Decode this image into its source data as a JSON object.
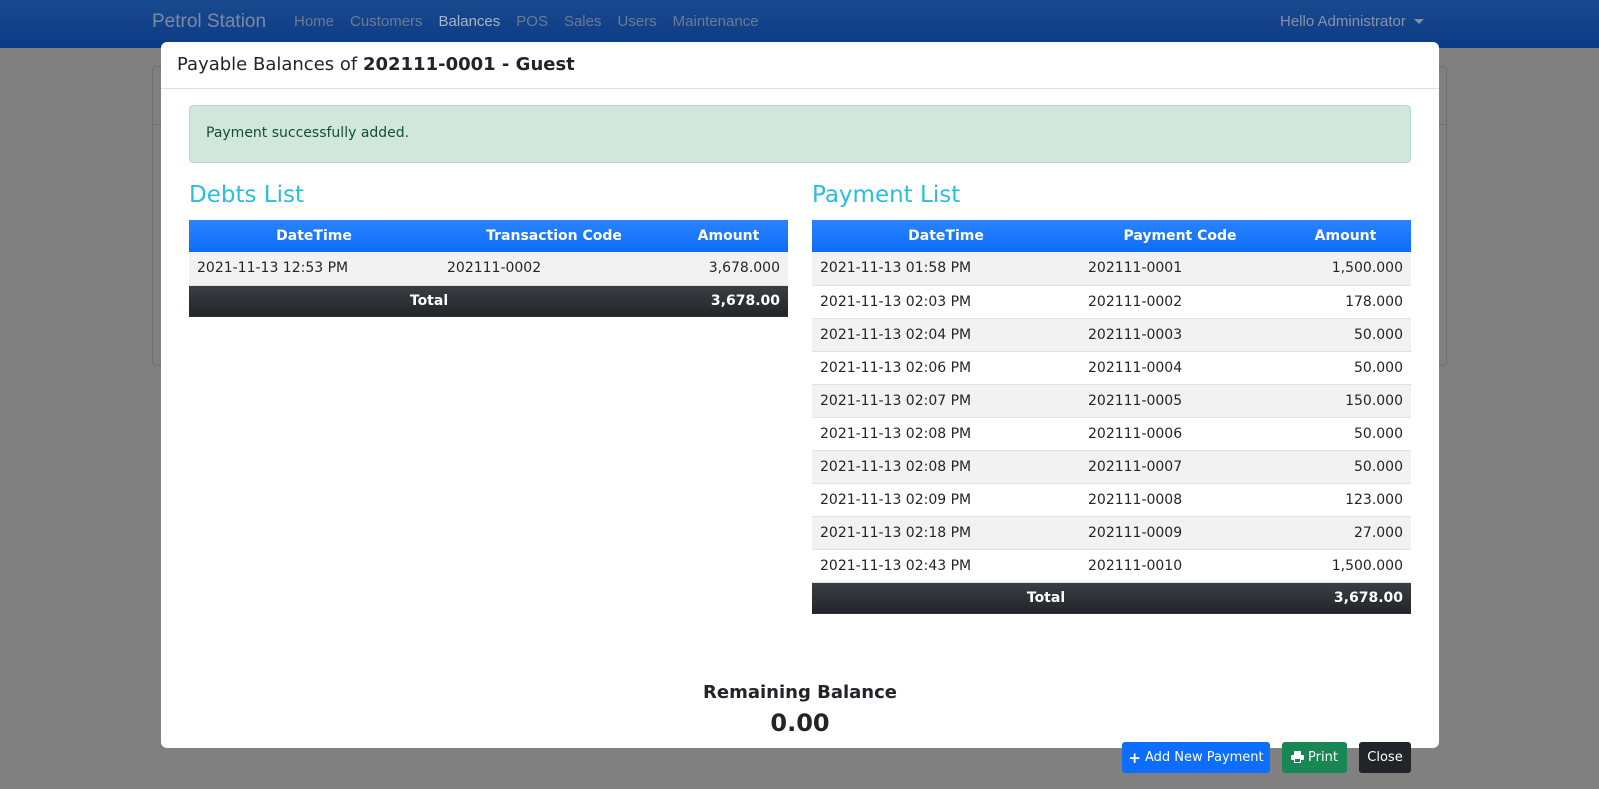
{
  "navbar": {
    "brand": "Petrol Station",
    "links": [
      {
        "label": "Home",
        "active": false
      },
      {
        "label": "Customers",
        "active": false
      },
      {
        "label": "Balances",
        "active": true
      },
      {
        "label": "POS",
        "active": false
      },
      {
        "label": "Sales",
        "active": false
      },
      {
        "label": "Users",
        "active": false
      },
      {
        "label": "Maintenance",
        "active": false
      }
    ],
    "user_menu": "Hello Administrator"
  },
  "modal": {
    "title_prefix": "Payable Balances of ",
    "title_bold": "202111-0001 - Guest",
    "alert": "Payment successfully added.",
    "debts": {
      "title": "Debts List",
      "headers": [
        "DateTime",
        "Transaction Code",
        "Amount"
      ],
      "rows": [
        {
          "datetime": "2021-11-13 12:53 PM",
          "code": "202111-0002",
          "amount": "3,678.000"
        }
      ],
      "total_label": "Total",
      "total_value": "3,678.00"
    },
    "payments": {
      "title": "Payment List",
      "headers": [
        "DateTime",
        "Payment Code",
        "Amount"
      ],
      "rows": [
        {
          "datetime": "2021-11-13 01:58 PM",
          "code": "202111-0001",
          "amount": "1,500.000"
        },
        {
          "datetime": "2021-11-13 02:03 PM",
          "code": "202111-0002",
          "amount": "178.000"
        },
        {
          "datetime": "2021-11-13 02:04 PM",
          "code": "202111-0003",
          "amount": "50.000"
        },
        {
          "datetime": "2021-11-13 02:06 PM",
          "code": "202111-0004",
          "amount": "50.000"
        },
        {
          "datetime": "2021-11-13 02:07 PM",
          "code": "202111-0005",
          "amount": "150.000"
        },
        {
          "datetime": "2021-11-13 02:08 PM",
          "code": "202111-0006",
          "amount": "50.000"
        },
        {
          "datetime": "2021-11-13 02:08 PM",
          "code": "202111-0007",
          "amount": "50.000"
        },
        {
          "datetime": "2021-11-13 02:09 PM",
          "code": "202111-0008",
          "amount": "123.000"
        },
        {
          "datetime": "2021-11-13 02:18 PM",
          "code": "202111-0009",
          "amount": "27.000"
        },
        {
          "datetime": "2021-11-13 02:43 PM",
          "code": "202111-0010",
          "amount": "1,500.000"
        }
      ],
      "total_label": "Total",
      "total_value": "3,678.00"
    },
    "remaining_label": "Remaining Balance",
    "remaining_value": "0.00",
    "buttons": {
      "add_payment": "Add New Payment",
      "add_payment_icon": "plus-icon",
      "print": "Print",
      "print_icon": "printer-icon",
      "close": "Close"
    }
  },
  "colors": {
    "navbar": "#10408a",
    "section_title": "#2bbde0",
    "table_header": "#0d6efd",
    "table_footer": "#212529",
    "alert_bg": "#d1e7dd",
    "btn_primary": "#0d6efd",
    "btn_success": "#198754",
    "btn_dark": "#212529"
  }
}
